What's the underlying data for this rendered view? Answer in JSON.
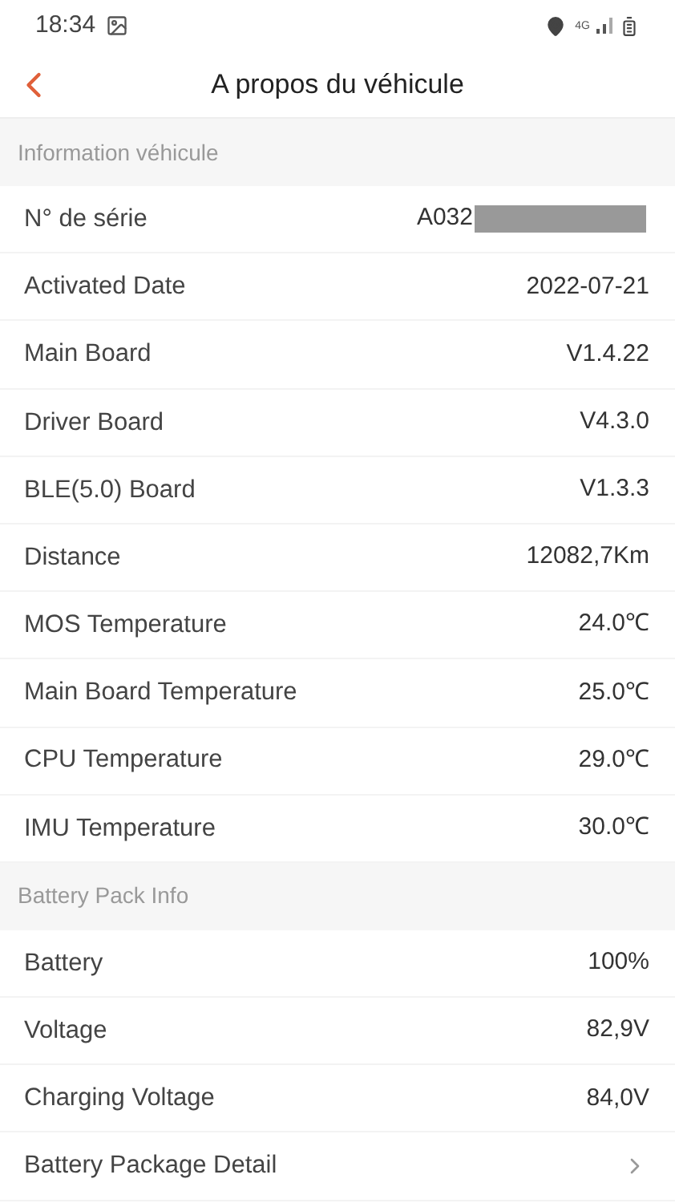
{
  "status_bar": {
    "time": "18:34",
    "network": "4G"
  },
  "header": {
    "title": "A propos du véhicule"
  },
  "sections": [
    {
      "title": "Information véhicule",
      "rows": [
        {
          "kind": "value",
          "label": "N° de série",
          "value": "A032",
          "redacted": true
        },
        {
          "kind": "value",
          "label": "Activated Date",
          "value": "2022-07-21",
          "redacted": false
        },
        {
          "kind": "value",
          "label": "Main Board",
          "value": "V1.4.22",
          "redacted": false
        },
        {
          "kind": "value",
          "label": "Driver Board",
          "value": "V4.3.0",
          "redacted": false
        },
        {
          "kind": "value",
          "label": "BLE(5.0) Board",
          "value": "V1.3.3",
          "redacted": false
        },
        {
          "kind": "value",
          "label": "Distance",
          "value": "12082,7Km",
          "redacted": false
        },
        {
          "kind": "value",
          "label": "MOS Temperature",
          "value": "24.0℃",
          "redacted": false
        },
        {
          "kind": "value",
          "label": "Main Board Temperature",
          "value": "25.0℃",
          "redacted": false
        },
        {
          "kind": "value",
          "label": "CPU Temperature",
          "value": "29.0℃",
          "redacted": false
        },
        {
          "kind": "value",
          "label": "IMU Temperature",
          "value": "30.0℃",
          "redacted": false
        }
      ]
    },
    {
      "title": "Battery Pack Info",
      "rows": [
        {
          "kind": "value",
          "label": "Battery",
          "value": "100%",
          "redacted": false
        },
        {
          "kind": "value",
          "label": "Voltage",
          "value": "82,9V",
          "redacted": false
        },
        {
          "kind": "value",
          "label": "Charging Voltage",
          "value": "84,0V",
          "redacted": false
        },
        {
          "kind": "link",
          "label": "Battery Package Detail"
        }
      ]
    }
  ]
}
